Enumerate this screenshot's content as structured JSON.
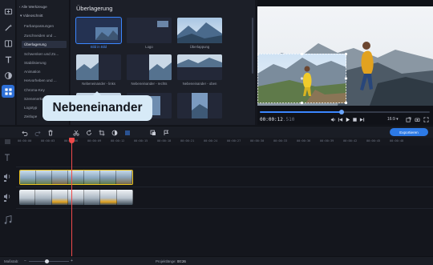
{
  "sidebar": {
    "icons": [
      "import-icon",
      "magic-wand-icon",
      "transitions-icon",
      "titles-icon",
      "filters-icon",
      "more-tools-icon"
    ],
    "active_index": 5,
    "active_color": "#2d6fd6"
  },
  "tools": {
    "all_tools": "Alle Werkzeuge",
    "section": "Videoschnitt",
    "items": [
      "Farbanpassungen",
      "Zuschneiden und ...",
      "Überlagerung",
      "Schwenken und Zo...",
      "Stabilisierung",
      "Animation",
      "Hervorheben und ...",
      "Chroma-Key",
      "Szenenerkennung",
      "Logotyp",
      "Zeitlupe"
    ],
    "selected_index": 2
  },
  "library": {
    "title": "Überlagerung",
    "tiles": [
      {
        "label": "Bild in Bild",
        "selected": true
      },
      {
        "label": "Logo",
        "selected": false
      },
      {
        "label": "Überlappung",
        "selected": false
      },
      {
        "label": "Nebeneinander - links",
        "selected": false
      },
      {
        "label": "Nebeneinander - rechts",
        "selected": false
      },
      {
        "label": "Nebeneinander - oben",
        "selected": false
      },
      {
        "label": "",
        "selected": false
      },
      {
        "label": "",
        "selected": false
      },
      {
        "label": "",
        "selected": false
      }
    ],
    "selected_color": "#3b86ff"
  },
  "tooltip": {
    "text": "Nebeneinander"
  },
  "preview": {
    "timecode": "00:00:12",
    "timecode_frac": ".510",
    "progress": 0.48,
    "aspect": "16:9 ▾"
  },
  "toolbar": {
    "export_label": "Exportieren",
    "export_color": "#2d7ae6",
    "icons": [
      "undo-icon",
      "redo-icon",
      "delete-icon",
      "cut-icon",
      "rotate-icon",
      "crop-icon",
      "color-icon",
      "clip-properties-icon",
      "overlay-icon",
      "marker-icon"
    ]
  },
  "timeline": {
    "ruler_labels": [
      "00:00:00",
      "00:00:03",
      "00:00:06",
      "00:00:09",
      "00:00:12",
      "00:00:15",
      "00:00:18",
      "00:00:21",
      "00:00:24",
      "00:00:27",
      "00:00:30",
      "00:00:33",
      "00:00:36",
      "00:00:39",
      "00:00:42",
      "00:00:45",
      "00:00:48"
    ],
    "playhead_color": "#ef4a4a",
    "overlay_border_color": "#e9c01e"
  },
  "status": {
    "zoom_label": "Maßstab:",
    "duration_label": "Projektlänge:",
    "duration_value": "00:26",
    "zoom_level": 0.45
  }
}
